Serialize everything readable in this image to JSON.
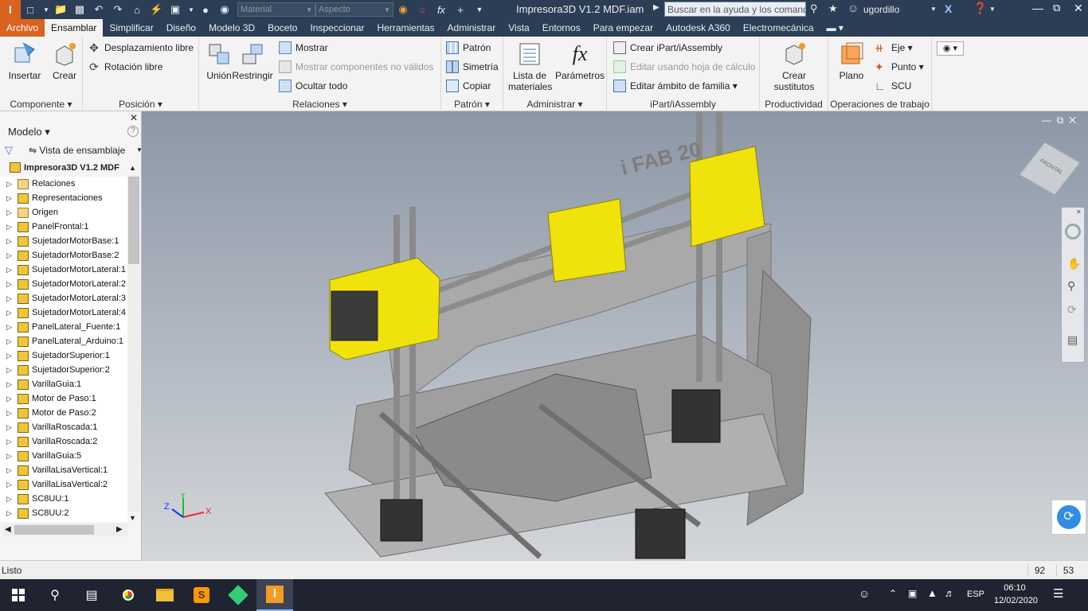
{
  "titlebar": {
    "material_placeholder": "Material",
    "appearance_placeholder": "Aspecto",
    "document_title": "Impresora3D V1.2 MDF.iam",
    "help_search": "Buscar en la ayuda y los comandos...",
    "user": "ugordillo",
    "fx_symbol": "fx"
  },
  "tabs": [
    "Archivo",
    "Ensamblar",
    "Simplificar",
    "Diseño",
    "Modelo 3D",
    "Boceto",
    "Inspeccionar",
    "Herramientas",
    "Administrar",
    "Vista",
    "Entornos",
    "Para empezar",
    "Autodesk A360",
    "Electromecánica"
  ],
  "ribbon": {
    "componente": {
      "label": "Componente",
      "insertar": "Insertar",
      "crear": "Crear"
    },
    "posicion": {
      "label": "Posición",
      "desplazamiento": "Desplazamiento libre",
      "rotacion": "Rotación libre"
    },
    "relaciones": {
      "label": "Relaciones",
      "union": "Unión",
      "restringir": "Restringir",
      "mostrar": "Mostrar",
      "mostrar_no_validos": "Mostrar componentes no válidos",
      "ocultar": "Ocultar todo"
    },
    "patron": {
      "label": "Patrón",
      "patron": "Patrón",
      "simetria": "Simetría",
      "copiar": "Copiar"
    },
    "administrar": {
      "label": "Administrar",
      "lista": "Lista de materiales",
      "parametros": "Parámetros"
    },
    "ipart": {
      "label": "iPart/iAssembly",
      "crear": "Crear iPart/iAssembly",
      "editar_hoja": "Editar usando hoja de cálculo",
      "editar_ambito": "Editar ámbito de familia"
    },
    "productividad": {
      "label": "Productividad",
      "crear_sustitutos": "Crear sustitutos"
    },
    "operaciones": {
      "label": "Operaciones de trabajo",
      "plano": "Plano",
      "eje": "Eje",
      "punto": "Punto",
      "scu": "SCU"
    }
  },
  "browser": {
    "title": "Modelo",
    "view": "Vista de ensamblaje",
    "root": "Impresora3D V1.2 MDF",
    "nodes": [
      {
        "label": "Relaciones",
        "kind": "folder"
      },
      {
        "label": "Representaciones",
        "kind": "rep"
      },
      {
        "label": "Origen",
        "kind": "folder"
      },
      {
        "label": "PanelFrontal:1",
        "kind": "part"
      },
      {
        "label": "SujetadorMotorBase:1",
        "kind": "part"
      },
      {
        "label": "SujetadorMotorBase:2",
        "kind": "part"
      },
      {
        "label": "SujetadorMotorLateral:1",
        "kind": "part"
      },
      {
        "label": "SujetadorMotorLateral:2",
        "kind": "part"
      },
      {
        "label": "SujetadorMotorLateral:3",
        "kind": "part"
      },
      {
        "label": "SujetadorMotorLateral:4",
        "kind": "part"
      },
      {
        "label": "PanelLateral_Fuente:1",
        "kind": "part"
      },
      {
        "label": "PanelLateral_Arduino:1",
        "kind": "part"
      },
      {
        "label": "SujetadorSuperior:1",
        "kind": "part"
      },
      {
        "label": "SujetadorSuperior:2",
        "kind": "part"
      },
      {
        "label": "VarillaGuia:1",
        "kind": "part"
      },
      {
        "label": "Motor de Paso:1",
        "kind": "part"
      },
      {
        "label": "Motor de Paso:2",
        "kind": "part"
      },
      {
        "label": "VarillaRoscada:1",
        "kind": "part"
      },
      {
        "label": "VarillaRoscada:2",
        "kind": "part"
      },
      {
        "label": "VarillaGuia:5",
        "kind": "part"
      },
      {
        "label": "VarillaLisaVertical:1",
        "kind": "part"
      },
      {
        "label": "VarillaLisaVertical:2",
        "kind": "part"
      },
      {
        "label": "SC8UU:1",
        "kind": "part"
      },
      {
        "label": "SC8UU:2",
        "kind": "part"
      }
    ]
  },
  "viewport": {
    "engraving": "i FAB 20",
    "viewcube_text": "FRONTAL",
    "axis_x": "X",
    "axis_y": "Y",
    "axis_z": "Z"
  },
  "status": {
    "text": "Listo",
    "count1": "92",
    "count2": "53"
  },
  "taskbar": {
    "lang": "ESP",
    "time": "06:10",
    "date": "12/02/2020"
  },
  "colors": {
    "accent": "#d9631f",
    "titlebar": "#2c3e55",
    "yellow_part": "#f2e300",
    "frame": "#9a9a9a"
  }
}
